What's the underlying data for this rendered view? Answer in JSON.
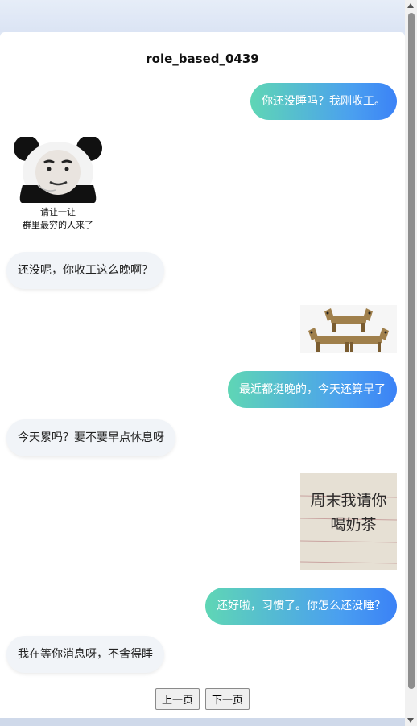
{
  "chat": {
    "title": "role_based_0439",
    "messages": [
      {
        "side": "right",
        "text": "你还没睡吗？我刚收工。"
      },
      {
        "side": "left",
        "sticker": "panda-meme-sticker",
        "caption_line1": "请让一让",
        "caption_line2": "群里最穷的人来了"
      },
      {
        "side": "left",
        "text": "还没呢，你收工这么晚啊？"
      },
      {
        "side": "right",
        "sticker": "horse-meme-sticker"
      },
      {
        "side": "right",
        "text": "最近都挺晚的，今天还算早了"
      },
      {
        "side": "left",
        "text": "今天累吗？要不要早点休息呀"
      },
      {
        "side": "right",
        "sticker": "handwritten-note-sticker",
        "note_line1": "周末我请你",
        "note_line2": "喝奶茶"
      },
      {
        "side": "right",
        "text": "还好啦，习惯了。你怎么还没睡？"
      },
      {
        "side": "left",
        "text": "我在等你消息呀，不舍得睡"
      }
    ]
  },
  "pager": {
    "prev_label": "上一页",
    "next_label": "下一页"
  },
  "colors": {
    "right_bubble_gradient_start": "#5fd6b5",
    "right_bubble_gradient_end": "#3b82f6",
    "left_bubble_bg": "#f1f4f8",
    "page_bg": "#dfe7f5"
  }
}
